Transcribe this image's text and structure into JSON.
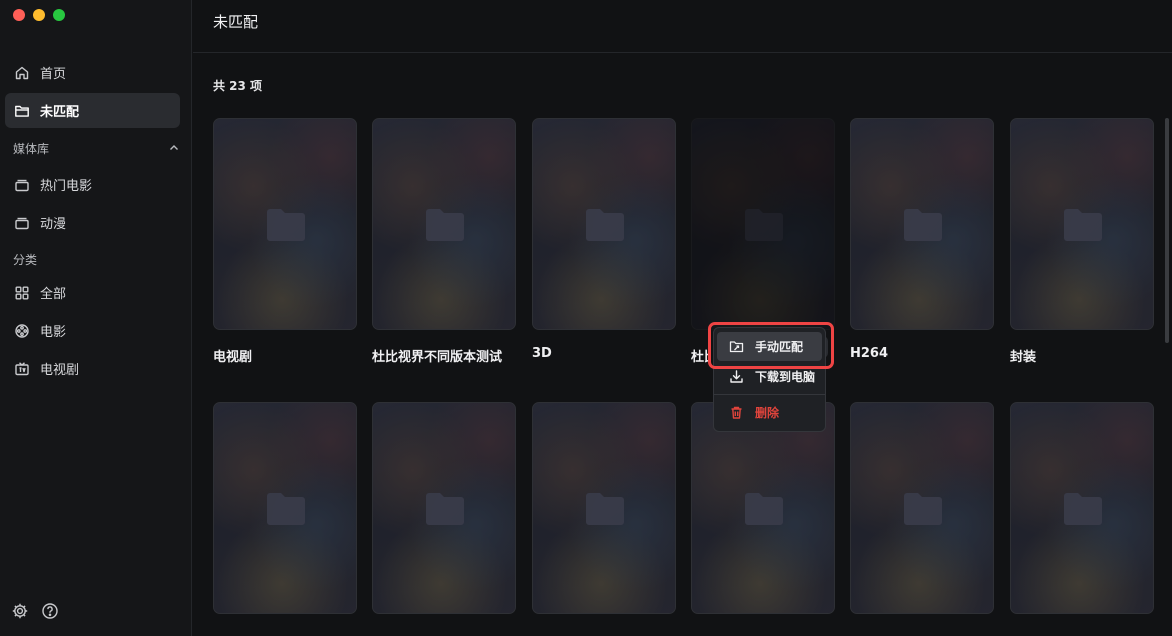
{
  "window": {
    "traffic_colors": [
      "#fe5f57",
      "#febc2e",
      "#28c840"
    ]
  },
  "sidebar": {
    "top_items": [
      {
        "label": "首页",
        "icon": "home-icon"
      },
      {
        "label": "未匹配",
        "icon": "folder-icon",
        "active": true
      }
    ],
    "library_section": {
      "label": "媒体库",
      "items": [
        {
          "label": "热门电影",
          "icon": "library-icon"
        },
        {
          "label": "动漫",
          "icon": "library-icon"
        }
      ]
    },
    "category_section": {
      "label": "分类",
      "items": [
        {
          "label": "全部",
          "icon": "grid-icon"
        },
        {
          "label": "电影",
          "icon": "film-reel-icon"
        },
        {
          "label": "电视剧",
          "icon": "tv-icon"
        }
      ]
    },
    "bottom_icons": [
      "settings-icon",
      "help-icon"
    ]
  },
  "main": {
    "title": "未匹配",
    "count_label": "共 23 项",
    "cards_row1": [
      {
        "label": "电视剧"
      },
      {
        "label": "杜比视界不同版本测试"
      },
      {
        "label": "3D"
      },
      {
        "label": "杜比"
      },
      {
        "label": "H264"
      },
      {
        "label": "封装"
      }
    ],
    "cards_row2_count": 6
  },
  "context_menu": {
    "items": [
      {
        "label": "手动匹配",
        "icon": "manual-match-icon"
      },
      {
        "label": "下载到电脑",
        "icon": "download-icon"
      },
      {
        "label": "删除",
        "icon": "trash-icon",
        "danger": true
      }
    ]
  },
  "colors": {
    "highlight_border": "#ef4444",
    "danger": "#e0443c",
    "background": "#111214"
  }
}
